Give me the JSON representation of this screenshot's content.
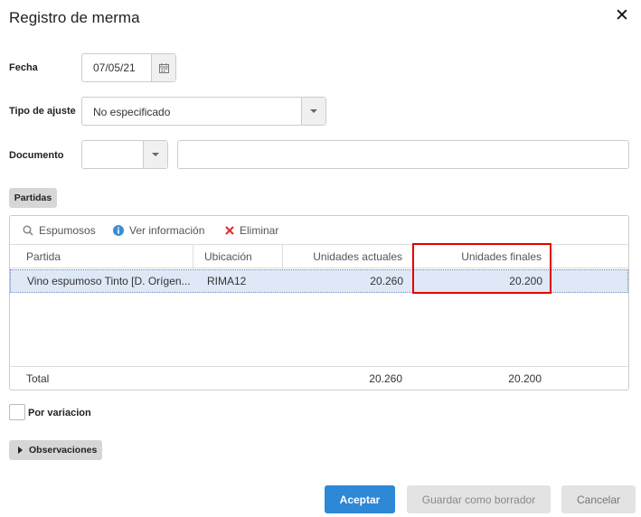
{
  "dialog": {
    "title": "Registro de merma",
    "close_glyph": "✕"
  },
  "form": {
    "fecha_label": "Fecha",
    "fecha_value": "07/05/21",
    "tipo_label": "Tipo de ajuste",
    "tipo_value": "No especificado",
    "documento_label": "Documento",
    "documento_type_value": "",
    "documento_value": ""
  },
  "partidas": {
    "section_label": "Partidas",
    "toolbar": {
      "espumosos": "Espumosos",
      "ver_info": "Ver información",
      "eliminar": "Eliminar"
    },
    "columns": [
      "Partida",
      "Ubicación",
      "Unidades actuales",
      "Unidades finales"
    ],
    "rows": [
      {
        "partida": "Vino espumoso Tinto [D. Orígen...",
        "ubicacion": "RIMA12",
        "actuales": "20.260",
        "finales": "20.200"
      }
    ],
    "footer": {
      "label": "Total",
      "actuales": "20.260",
      "finales": "20.200"
    }
  },
  "por_variacion_label": "Por variacion",
  "observaciones_label": "Observaciones",
  "buttons": {
    "accept": "Aceptar",
    "draft": "Guardar como borrador",
    "cancel": "Cancelar"
  },
  "colors": {
    "primary": "#2d88d6",
    "highlight": "#e00000",
    "selected_row": "#dfe8f7"
  },
  "icons": [
    "calendar-icon",
    "chevron-down-icon",
    "search-icon",
    "info-icon",
    "delete-icon",
    "caret-right-icon",
    "close-icon"
  ]
}
